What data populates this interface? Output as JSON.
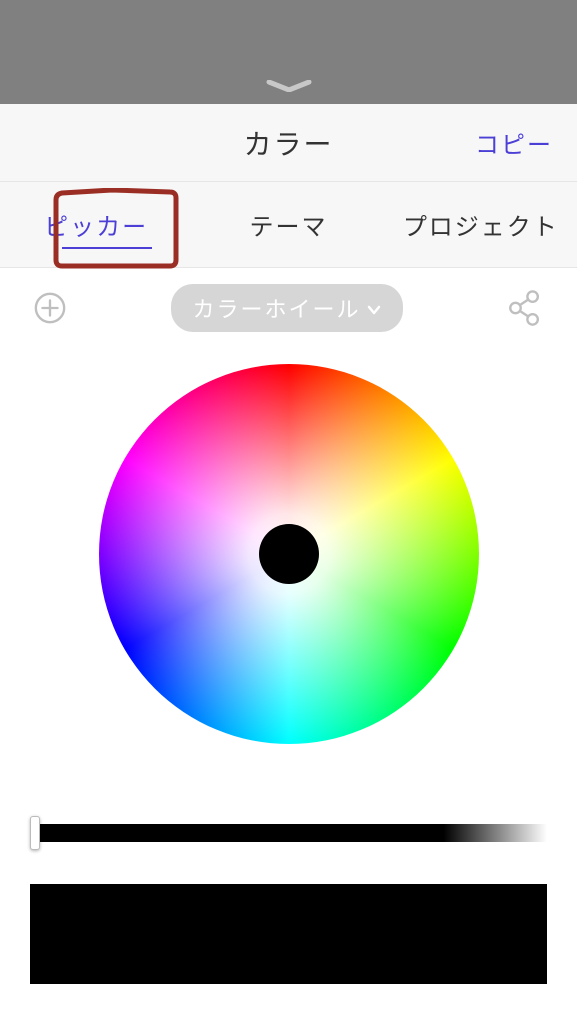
{
  "header": {
    "title": "カラー",
    "copy_label": "コピー"
  },
  "tabs": {
    "items": [
      {
        "label": "ピッカー",
        "active": true
      },
      {
        "label": "テーマ",
        "active": false
      },
      {
        "label": "プロジェクト",
        "active": false
      }
    ]
  },
  "toolbar": {
    "mode_label": "カラーホイール"
  },
  "colors": {
    "accent": "#4b3fd6",
    "selected": "#000000"
  },
  "brightness": {
    "value": 0
  }
}
